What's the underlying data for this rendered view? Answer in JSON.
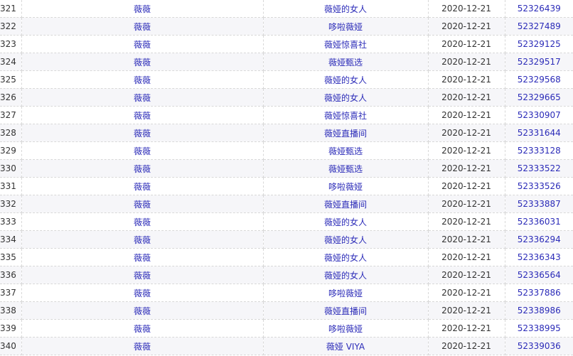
{
  "rows": [
    {
      "index": "321",
      "anchor": "薇薇",
      "room": "薇娅的女人",
      "date": "2020-12-21",
      "id": "52326439"
    },
    {
      "index": "322",
      "anchor": "薇薇",
      "room": "哆啦薇娅",
      "date": "2020-12-21",
      "id": "52327489"
    },
    {
      "index": "323",
      "anchor": "薇薇",
      "room": "薇娅惊喜社",
      "date": "2020-12-21",
      "id": "52329125"
    },
    {
      "index": "324",
      "anchor": "薇薇",
      "room": "薇娅甄选",
      "date": "2020-12-21",
      "id": "52329517"
    },
    {
      "index": "325",
      "anchor": "薇薇",
      "room": "薇娅的女人",
      "date": "2020-12-21",
      "id": "52329568"
    },
    {
      "index": "326",
      "anchor": "薇薇",
      "room": "薇娅的女人",
      "date": "2020-12-21",
      "id": "52329665"
    },
    {
      "index": "327",
      "anchor": "薇薇",
      "room": "薇娅惊喜社",
      "date": "2020-12-21",
      "id": "52330907"
    },
    {
      "index": "328",
      "anchor": "薇薇",
      "room": "薇娅直播间",
      "date": "2020-12-21",
      "id": "52331644"
    },
    {
      "index": "329",
      "anchor": "薇薇",
      "room": "薇娅甄选",
      "date": "2020-12-21",
      "id": "52333128"
    },
    {
      "index": "330",
      "anchor": "薇薇",
      "room": "薇娅甄选",
      "date": "2020-12-21",
      "id": "52333522"
    },
    {
      "index": "331",
      "anchor": "薇薇",
      "room": "哆啦薇娅",
      "date": "2020-12-21",
      "id": "52333526"
    },
    {
      "index": "332",
      "anchor": "薇薇",
      "room": "薇娅直播间",
      "date": "2020-12-21",
      "id": "52333887"
    },
    {
      "index": "333",
      "anchor": "薇薇",
      "room": "薇娅的女人",
      "date": "2020-12-21",
      "id": "52336031"
    },
    {
      "index": "334",
      "anchor": "薇薇",
      "room": "薇娅的女人",
      "date": "2020-12-21",
      "id": "52336294"
    },
    {
      "index": "335",
      "anchor": "薇薇",
      "room": "薇娅的女人",
      "date": "2020-12-21",
      "id": "52336343"
    },
    {
      "index": "336",
      "anchor": "薇薇",
      "room": "薇娅的女人",
      "date": "2020-12-21",
      "id": "52336564"
    },
    {
      "index": "337",
      "anchor": "薇薇",
      "room": "哆啦薇娅",
      "date": "2020-12-21",
      "id": "52337886"
    },
    {
      "index": "338",
      "anchor": "薇薇",
      "room": "薇娅直播间",
      "date": "2020-12-21",
      "id": "52338986"
    },
    {
      "index": "339",
      "anchor": "薇薇",
      "room": "哆啦薇娅",
      "date": "2020-12-21",
      "id": "52338995"
    },
    {
      "index": "340",
      "anchor": "薇薇",
      "room": "薇娅 VIYA",
      "date": "2020-12-21",
      "id": "52339036"
    }
  ],
  "colors": {
    "link": "#2b2bb8",
    "text": "#333333",
    "row_alt_bg": "#f6f6f9",
    "border": "#d8d8d8"
  }
}
